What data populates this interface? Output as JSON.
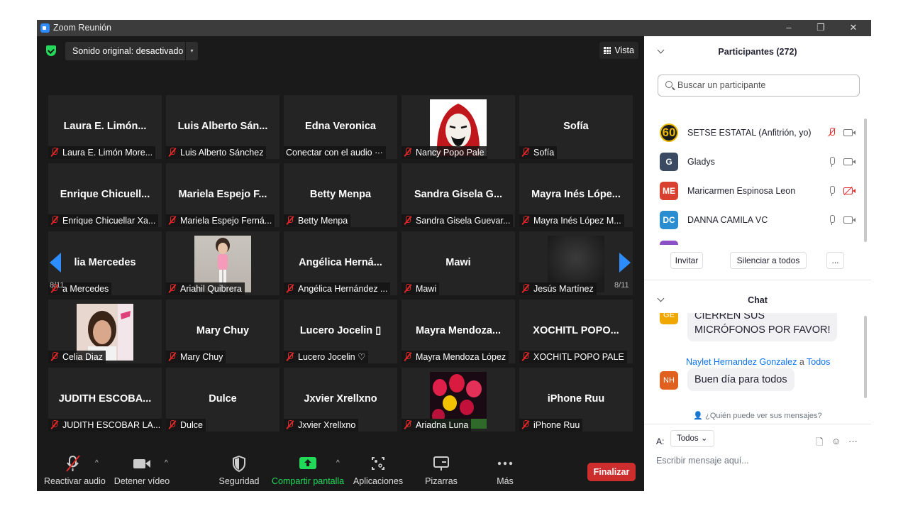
{
  "window": {
    "title": "Zoom Reunión",
    "minimize": "–",
    "restore": "❐",
    "close": "✕"
  },
  "meeting": {
    "sound_label": "Sonido original: desactivado",
    "sound_dropdown": "▾",
    "view_label": "Vista",
    "page_left": "8/11",
    "page_right": "8/11",
    "tiles": [
      {
        "big": "Laura E. Limón...",
        "label": "Laura E. Limón More..."
      },
      {
        "big": "Luis Alberto Sán...",
        "label": "Luis Alberto Sánchez"
      },
      {
        "big": "Edna Veronica",
        "label": "Conectar con el audio ·∙·"
      },
      {
        "big": "",
        "label": "Nancy Popo Pale"
      },
      {
        "big": "Sofía",
        "label": "Sofía"
      },
      {
        "big": "Enrique Chicuell...",
        "label": "Enrique Chicuellar Xa..."
      },
      {
        "big": "Mariela Espejo F...",
        "label": "Mariela Espejo Ferná..."
      },
      {
        "big": "Betty Menpa",
        "label": "Betty Menpa"
      },
      {
        "big": "Sandra Gisela G...",
        "label": "Sandra Gisela Guevar..."
      },
      {
        "big": "Mayra Inés Lópe...",
        "label": "Mayra Inés López M..."
      },
      {
        "big": "lia Mercedes",
        "label": "a Mercedes"
      },
      {
        "big": "",
        "label": "Ariahil Quibrera"
      },
      {
        "big": "Angélica Herná...",
        "label": "Angélica Hernández ..."
      },
      {
        "big": "Mawi",
        "label": "Mawi"
      },
      {
        "big": "",
        "label": "Jesús Martínez"
      },
      {
        "big": "",
        "label": "Celia Diaz"
      },
      {
        "big": "Mary Chuy",
        "label": "Mary Chuy"
      },
      {
        "big": "Lucero Jocelin ▯",
        "label": "Lucero Jocelin ♡"
      },
      {
        "big": "Mayra Mendoza...",
        "label": "Mayra Mendoza López"
      },
      {
        "big": "XOCHITL POPO...",
        "label": "XOCHITL POPO PALE"
      },
      {
        "big": "JUDITH ESCOBA...",
        "label": "JUDITH ESCOBAR LA..."
      },
      {
        "big": "Dulce",
        "label": "Dulce"
      },
      {
        "big": "Jxvier Xrellxno",
        "label": "Jxvier Xrellxno"
      },
      {
        "big": "",
        "label": "Ariadna Luna"
      },
      {
        "big": "iPhone Ruu",
        "label": "iPhone Ruu"
      }
    ],
    "toolbar": {
      "audio": "Reactivar audio",
      "video": "Detener vídeo",
      "security": "Seguridad",
      "share": "Compartir pantalla",
      "apps": "Aplicaciones",
      "whiteboards": "Pizarras",
      "more": "Más",
      "end": "Finalizar",
      "caret": "^"
    }
  },
  "participants": {
    "header": "Participantes (272)",
    "search_placeholder": "Buscar un participante",
    "list": [
      {
        "initials": "60",
        "name": "SETSE ESTATAL (Anfitrión, yo)",
        "color": "#1b1b1b"
      },
      {
        "initials": "G",
        "name": "Gladys",
        "color": "#3a4a63"
      },
      {
        "initials": "ME",
        "name": "Maricarmen Espinosa Leon",
        "color": "#d8412f"
      },
      {
        "initials": "DC",
        "name": "DANNA CAMILA VC",
        "color": "#2a8dd0"
      }
    ],
    "invite": "Invitar",
    "mute_all": "Silenciar a todos",
    "more": "..."
  },
  "chat": {
    "header": "Chat",
    "msg1_initials": "GE",
    "msg1_text_1": "CIERREN SUS",
    "msg1_text_2": "MICRÓFONOS POR FAVOR!",
    "sender": "Naylet Hernandez Gonzalez",
    "sender_to": "a",
    "recipient": "Todos",
    "msg2_initials": "NH",
    "msg2_text": "Buen día para todos",
    "who_can_see": "¿Quién puede ver sus mensajes?",
    "to_label": "A:",
    "to_value": "Todos",
    "input_placeholder": "Escribir mensaje aquí...",
    "more": "···"
  },
  "colors": {
    "accent": "#2d8cff",
    "danger": "#cc2e2e",
    "green": "#23d959",
    "bg": "#1a1a1a"
  }
}
